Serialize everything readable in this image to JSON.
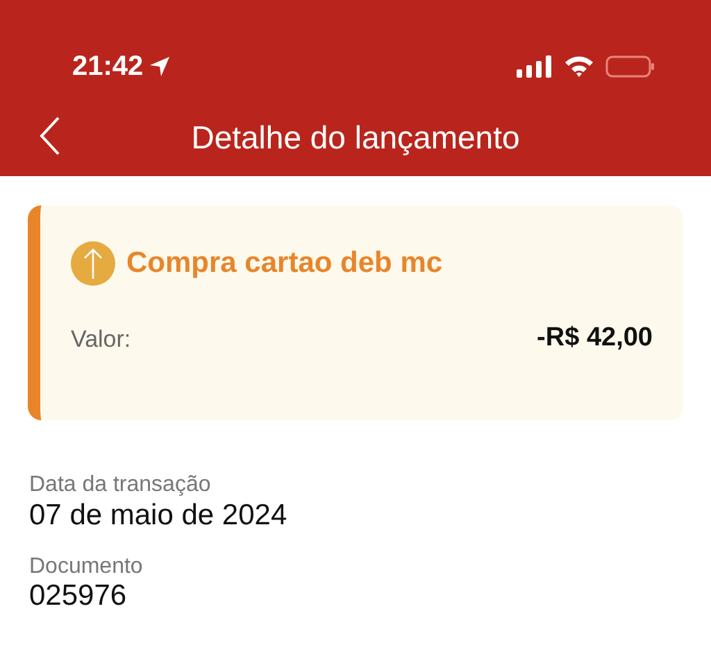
{
  "status_bar": {
    "time": "21:42"
  },
  "nav": {
    "title": "Detalhe do lançamento"
  },
  "transaction": {
    "title": "Compra cartao deb mc",
    "amount_label": "Valor:",
    "amount": "-R$ 42,00"
  },
  "fields": [
    {
      "label": "Data da transação",
      "value": "07 de maio de 2024"
    },
    {
      "label": "Documento",
      "value": "025976"
    }
  ]
}
